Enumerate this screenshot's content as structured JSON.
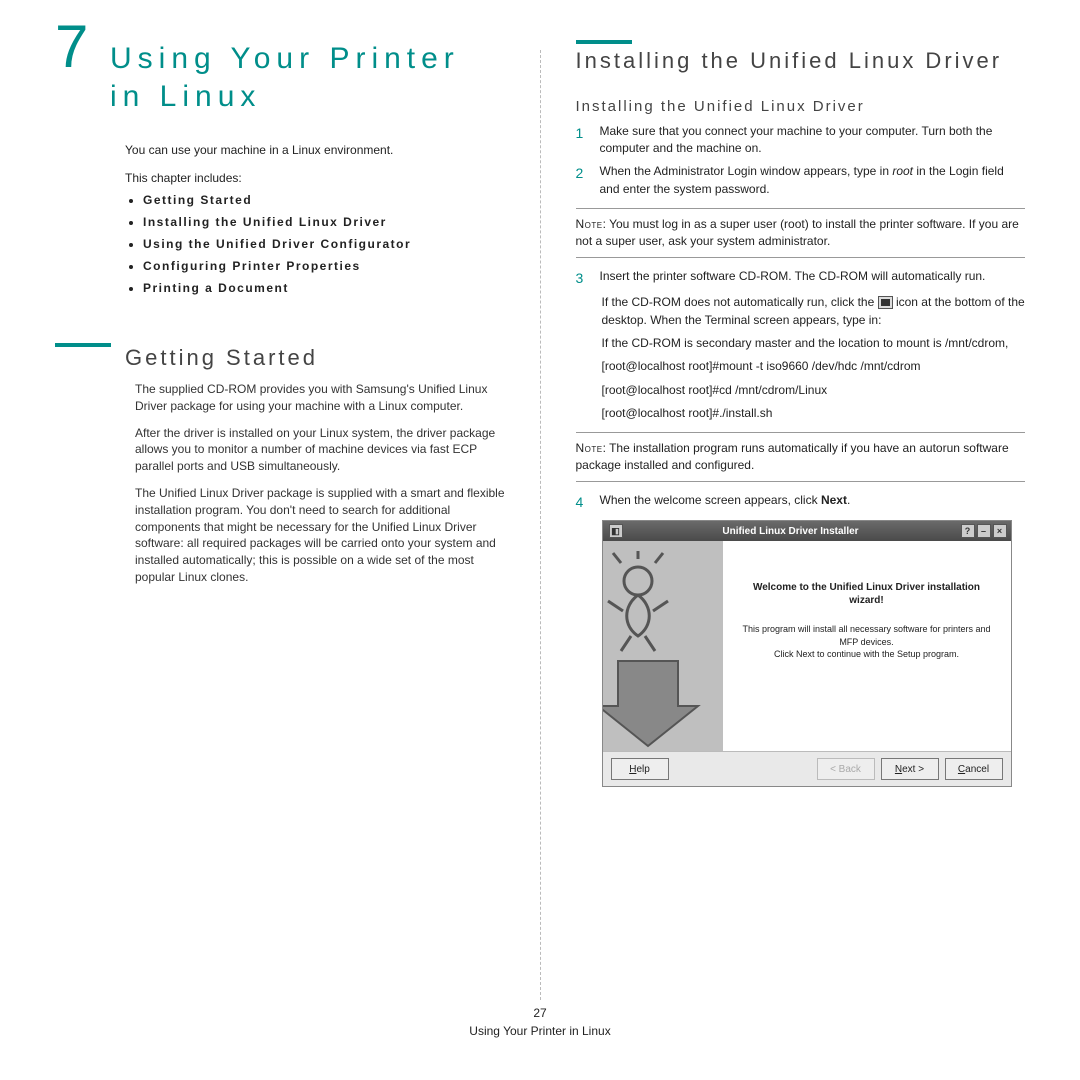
{
  "chapter": {
    "number": "7",
    "title": "Using Your Printer in Linux",
    "intro": "You can use your machine in a Linux environment.",
    "includes_label": "This chapter includes:",
    "toc": [
      "Getting Started",
      "Installing the Unified Linux Driver",
      "Using the Unified Driver Configurator",
      "Configuring Printer Properties",
      "Printing a Document"
    ]
  },
  "getting_started": {
    "heading": "Getting Started",
    "p1": "The supplied CD-ROM provides you with Samsung's Unified Linux Driver package for using your machine with a Linux computer.",
    "p2": "After the driver is installed on your Linux system, the driver package allows you to monitor a number of machine devices via fast ECP parallel ports and USB simultaneously.",
    "p3": "The Unified Linux Driver package is supplied with a smart and flexible installation program. You don't need to search for additional components that might be necessary for the Unified Linux Driver software: all required packages will be carried onto your system and installed automatically; this is possible on a wide set of the most popular Linux clones."
  },
  "installing": {
    "heading": "Installing the Unified Linux Driver",
    "subheading": "Installing the Unified Linux Driver",
    "step1": "Make sure that you connect your machine to your computer. Turn both the computer and the machine on.",
    "step2_a": "When the Administrator Login window appears, type in ",
    "step2_root": "root",
    "step2_b": " in the Login field and enter the system password.",
    "note1_label": "Note",
    "note1": ": You must log in as a super user (root) to install the printer software. If you are not a super user, ask your system administrator.",
    "step3": "Insert the printer software CD-ROM. The CD-ROM will automatically run.",
    "sub1_a": "If the CD-ROM does not automatically run, click the ",
    "sub1_b": " icon at the bottom of the desktop. When the Terminal screen appears, type in:",
    "sub2": "If the CD-ROM is secondary master and the location to mount is /mnt/cdrom,",
    "cmd1": "[root@localhost root]#mount -t iso9660 /dev/hdc /mnt/cdrom",
    "cmd2": "[root@localhost root]#cd /mnt/cdrom/Linux",
    "cmd3": "[root@localhost root]#./install.sh",
    "note2_label": "Note",
    "note2": ": The installation program runs automatically if you have an autorun software package installed and configured.",
    "step4_a": "When the welcome screen appears, click ",
    "step4_b": "Next",
    "step4_c": "."
  },
  "installer_dialog": {
    "title": "Unified Linux Driver Installer",
    "welcome": "Welcome to the Unified Linux Driver installation wizard!",
    "desc1": "This program will install all necessary software for printers and MFP devices.",
    "desc2": "Click Next to continue with the Setup program.",
    "help": "Help",
    "back": "< Back",
    "next": "Next >",
    "cancel": "Cancel"
  },
  "footer": {
    "page": "27",
    "title": "Using Your Printer in Linux"
  }
}
